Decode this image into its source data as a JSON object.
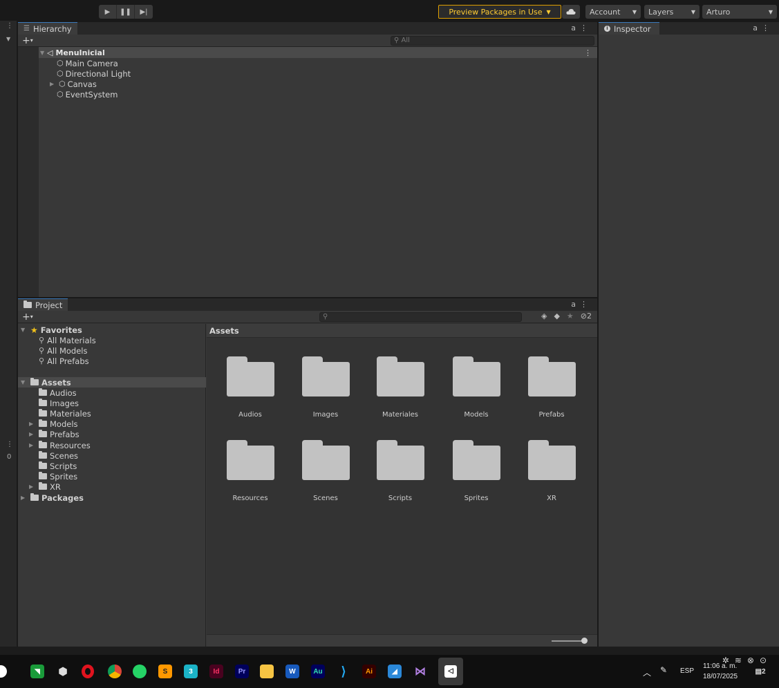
{
  "toolbar": {
    "preview_label": "Preview Packages in Use",
    "account_label": "Account",
    "layers_label": "Layers",
    "layout_label": "Arturo"
  },
  "hierarchy": {
    "tab_label": "Hierarchy",
    "search_placeholder": "All",
    "scene_name": "MenuInicial",
    "items": [
      {
        "label": "Main Camera"
      },
      {
        "label": "Directional Light"
      },
      {
        "label": "Canvas"
      },
      {
        "label": "EventSystem"
      }
    ]
  },
  "inspector": {
    "tab_label": "Inspector"
  },
  "project": {
    "tab_label": "Project",
    "hidden_count": "2",
    "favorites_label": "Favorites",
    "favorites": [
      "All Materials",
      "All Models",
      "All Prefabs"
    ],
    "assets_label": "Assets",
    "asset_folders": [
      "Audios",
      "Images",
      "Materiales",
      "Models",
      "Prefabs",
      "Resources",
      "Scenes",
      "Scripts",
      "Sprites",
      "XR"
    ],
    "packages_label": "Packages",
    "breadcrumb": "Assets",
    "grid": [
      "Audios",
      "Images",
      "Materiales",
      "Models",
      "Prefabs",
      "Resources",
      "Scenes",
      "Scripts",
      "Sprites",
      "XR"
    ]
  },
  "left_strip": {
    "number": "0"
  },
  "taskbar": {
    "apps": [
      "Camtasia",
      "Unity Hub",
      "Opera",
      "Chrome",
      "WhatsApp",
      "Sublime Text",
      "3",
      "InDesign",
      "Premiere Pro",
      "File Explorer",
      "Word",
      "Audition",
      "VS Code",
      "Illustrator",
      "Photos",
      "Visual Studio",
      "Unity"
    ],
    "app_letters": {
      "indesign": "Id",
      "premiere": "Pr",
      "word": "W",
      "audition": "Au",
      "illustrator": "Ai",
      "three": "3"
    },
    "language": "ESP",
    "time": "11:06 a. m.",
    "date": "18/07/2025",
    "notifications": "2"
  }
}
